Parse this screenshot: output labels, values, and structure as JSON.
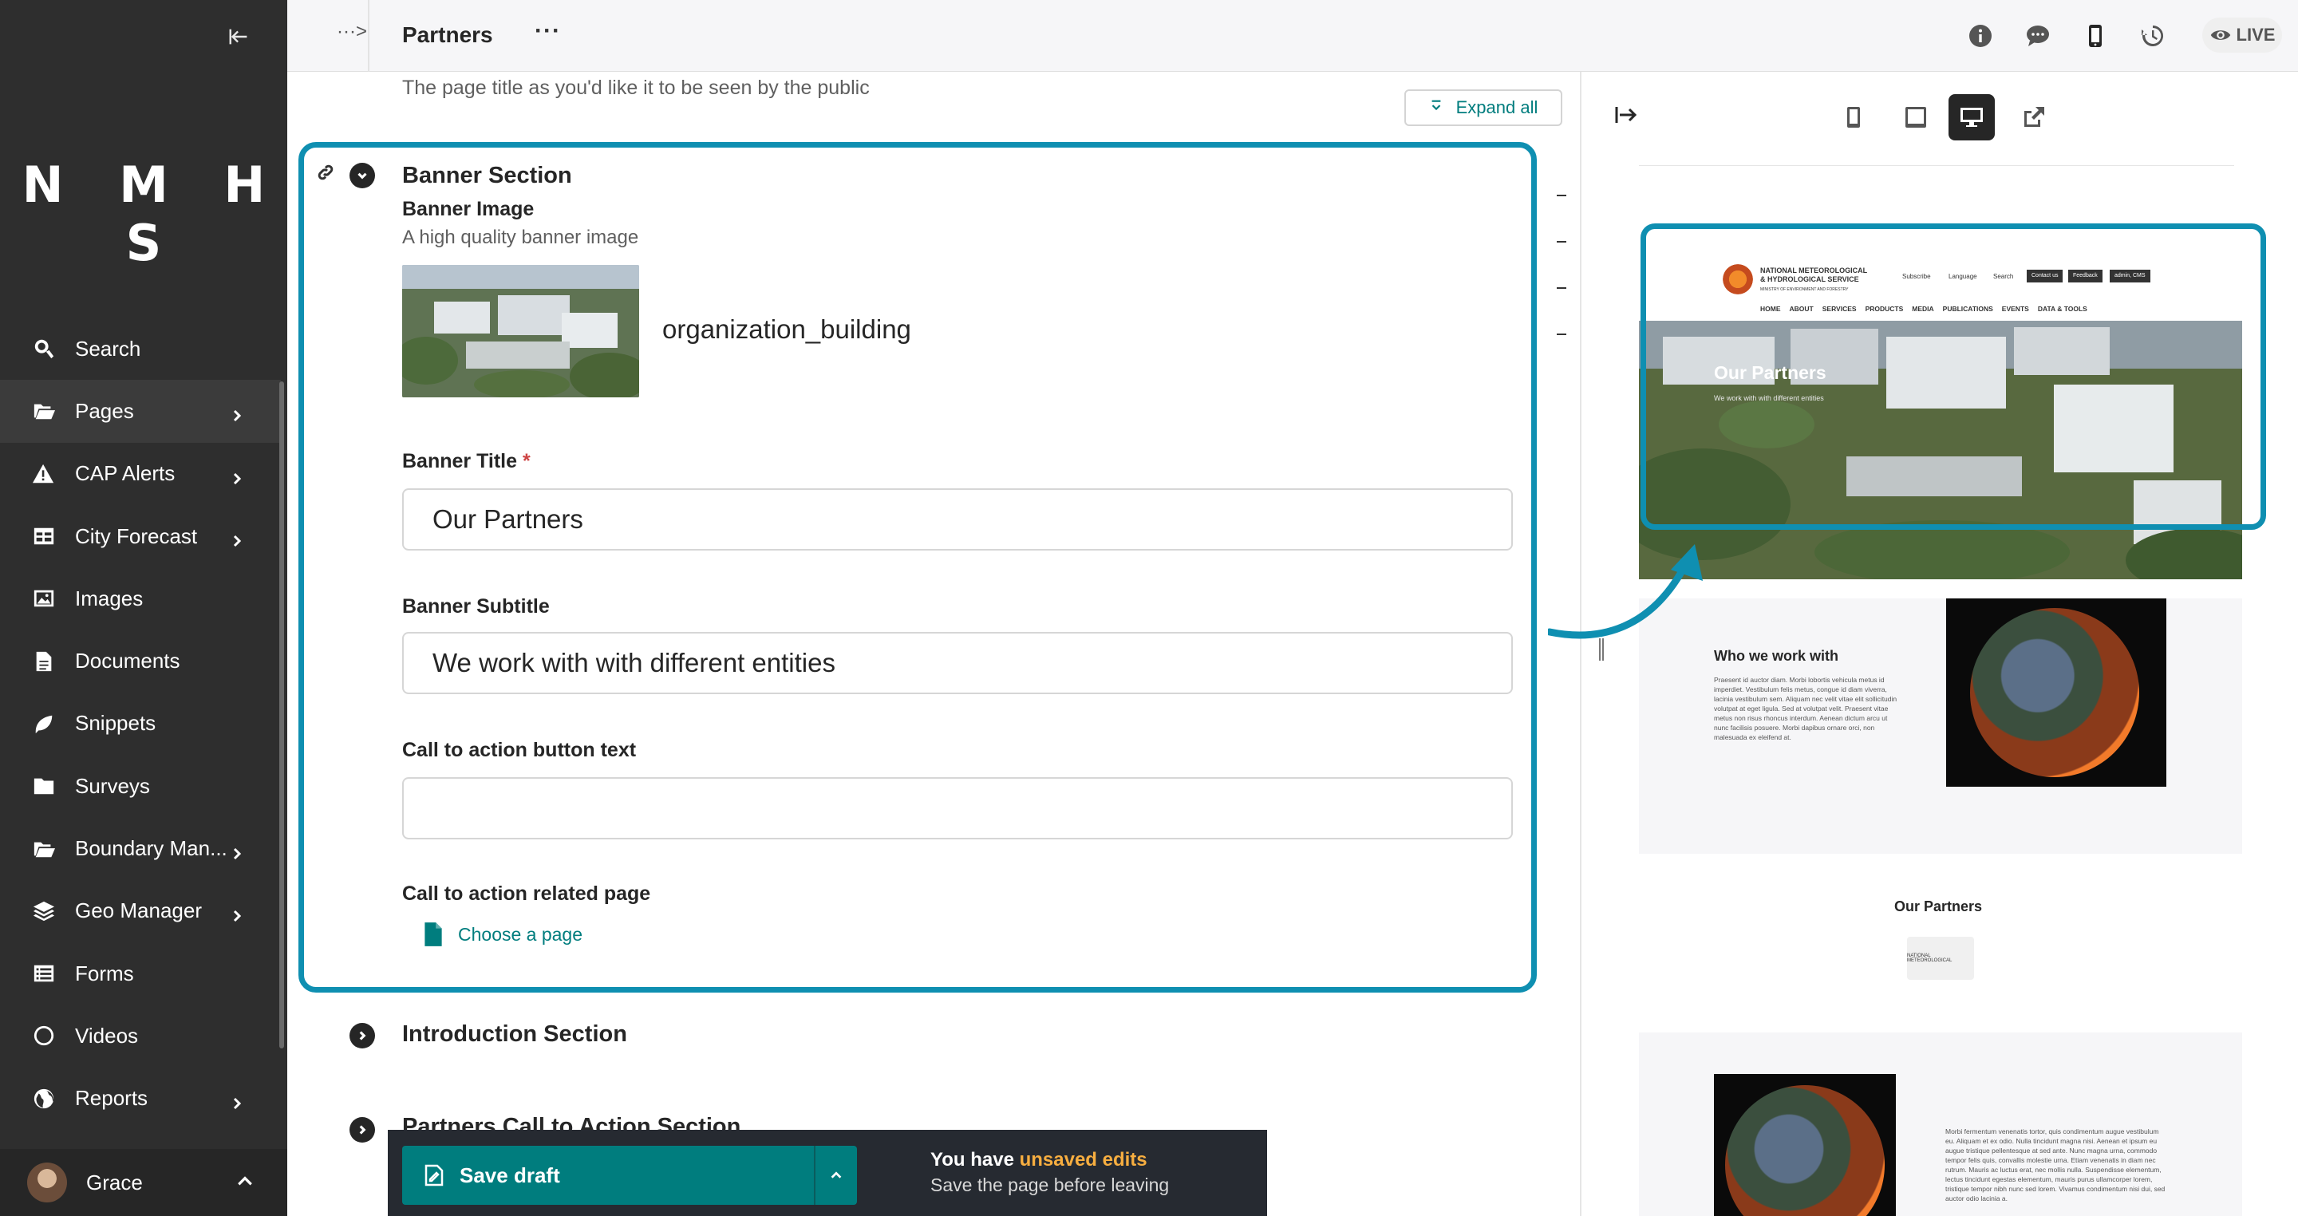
{
  "sidebar": {
    "logo": "N M H S",
    "items": [
      {
        "label": "Search",
        "icon": "search-icon",
        "chevron": false
      },
      {
        "label": "Pages",
        "icon": "folder-open-icon",
        "chevron": true
      },
      {
        "label": "CAP Alerts",
        "icon": "warning-icon",
        "chevron": true
      },
      {
        "label": "City Forecast",
        "icon": "table-icon",
        "chevron": true
      },
      {
        "label": "Images",
        "icon": "image-icon",
        "chevron": false
      },
      {
        "label": "Documents",
        "icon": "document-icon",
        "chevron": false
      },
      {
        "label": "Snippets",
        "icon": "snippet-icon",
        "chevron": false
      },
      {
        "label": "Surveys",
        "icon": "folder-icon",
        "chevron": false
      },
      {
        "label": "Boundary Man...",
        "icon": "folder-open-icon",
        "chevron": true
      },
      {
        "label": "Geo Manager",
        "icon": "layers-icon",
        "chevron": true
      },
      {
        "label": "Forms",
        "icon": "list-icon",
        "chevron": false
      },
      {
        "label": "Videos",
        "icon": "circle-icon",
        "chevron": false
      },
      {
        "label": "Reports",
        "icon": "globe-icon",
        "chevron": true
      }
    ],
    "user": {
      "name": "Grace"
    }
  },
  "topbar": {
    "breadcrumb_ellipsis": "···>",
    "title": "Partners",
    "more": "···",
    "live_label": "LIVE"
  },
  "editor": {
    "top_help": "The page title as you'd like it to be seen by the public",
    "expand_all": "Expand all",
    "banner_section": {
      "title": "Banner Section",
      "image_label": "Banner Image",
      "image_help": "A high quality banner image",
      "image_name": "organization_building",
      "title_label": "Banner Title",
      "title_required": "*",
      "title_value": "Our Partners",
      "subtitle_label": "Banner Subtitle",
      "subtitle_value": "We work with with different entities",
      "cta_text_label": "Call to action button text",
      "cta_text_value": "",
      "cta_page_label": "Call to action related page",
      "choose_page": "Choose a page"
    },
    "intro_section": "Introduction Section",
    "partners_cta_section": "Partners Call to Action Section"
  },
  "savebar": {
    "save_label": "Save draft",
    "unsaved_prefix": "You have ",
    "unsaved_highlight": "unsaved edits",
    "unsaved_help": "Save the page before leaving"
  },
  "preview": {
    "org_name": "NATIONAL METEOROLOGICAL & HYDROLOGICAL SERVICE",
    "org_sub": "MINISTRY OF ENVIRONMENT AND FORESTRY",
    "subscribe": "Subscribe",
    "language": "Language",
    "search": "Search",
    "contact_btn": "Contact us",
    "feedback_btn": "Feedback",
    "cms_btn": "admin, CMS",
    "nav": [
      "HOME",
      "ABOUT",
      "SERVICES",
      "PRODUCTS",
      "MEDIA",
      "PUBLICATIONS",
      "EVENTS",
      "DATA & TOOLS"
    ],
    "banner_title": "Our Partners",
    "banner_subtitle": "We work with with different entities",
    "who_title": "Who we work with",
    "who_text": "Praesent id auctor diam. Morbi lobortis vehicula metus id imperdiet. Vestibulum felis metus, congue id diam viverra, lacinia vestibulum sem. Aliquam nec velit vitae elit sollicitudin volutpat at eget ligula. Sed at volutpat velit. Praesent vitae metus non risus rhoncus interdum. Aenean dictum arcu ut nunc facilisis posuere. Morbi dapibus ornare orci, non malesuada ex eleifend at.",
    "partners_title": "Our Partners",
    "partner_logo_text": "NATIONAL METEOROLOGICAL",
    "lower_text": "Morbi fermentum venenatis tortor, quis condimentum augue vestibulum eu. Aliquam et ex odio. Nulla tincidunt magna nisi. Aenean et ipsum eu augue tristique pellentesque at sed ante. Nunc magna urna, commodo tempor felis quis, convallis molestie urna. Etiam venenatis in diam nec rutrum. Mauris ac luctus erat, nec mollis nulla. Suspendisse elementum, lectus tincidunt egestas elementum, mauris purus ullamcorper lorem, tristique tempor nibh nunc sed lorem. Vivamus condimentum nisi dui, sed auctor odio lacinia a."
  },
  "colors": {
    "accent_teal": "#007d7e",
    "highlight_blue": "#0f8fb1",
    "sidebar_bg": "#2e2e2e",
    "unsaved_orange": "#f7ae40"
  }
}
